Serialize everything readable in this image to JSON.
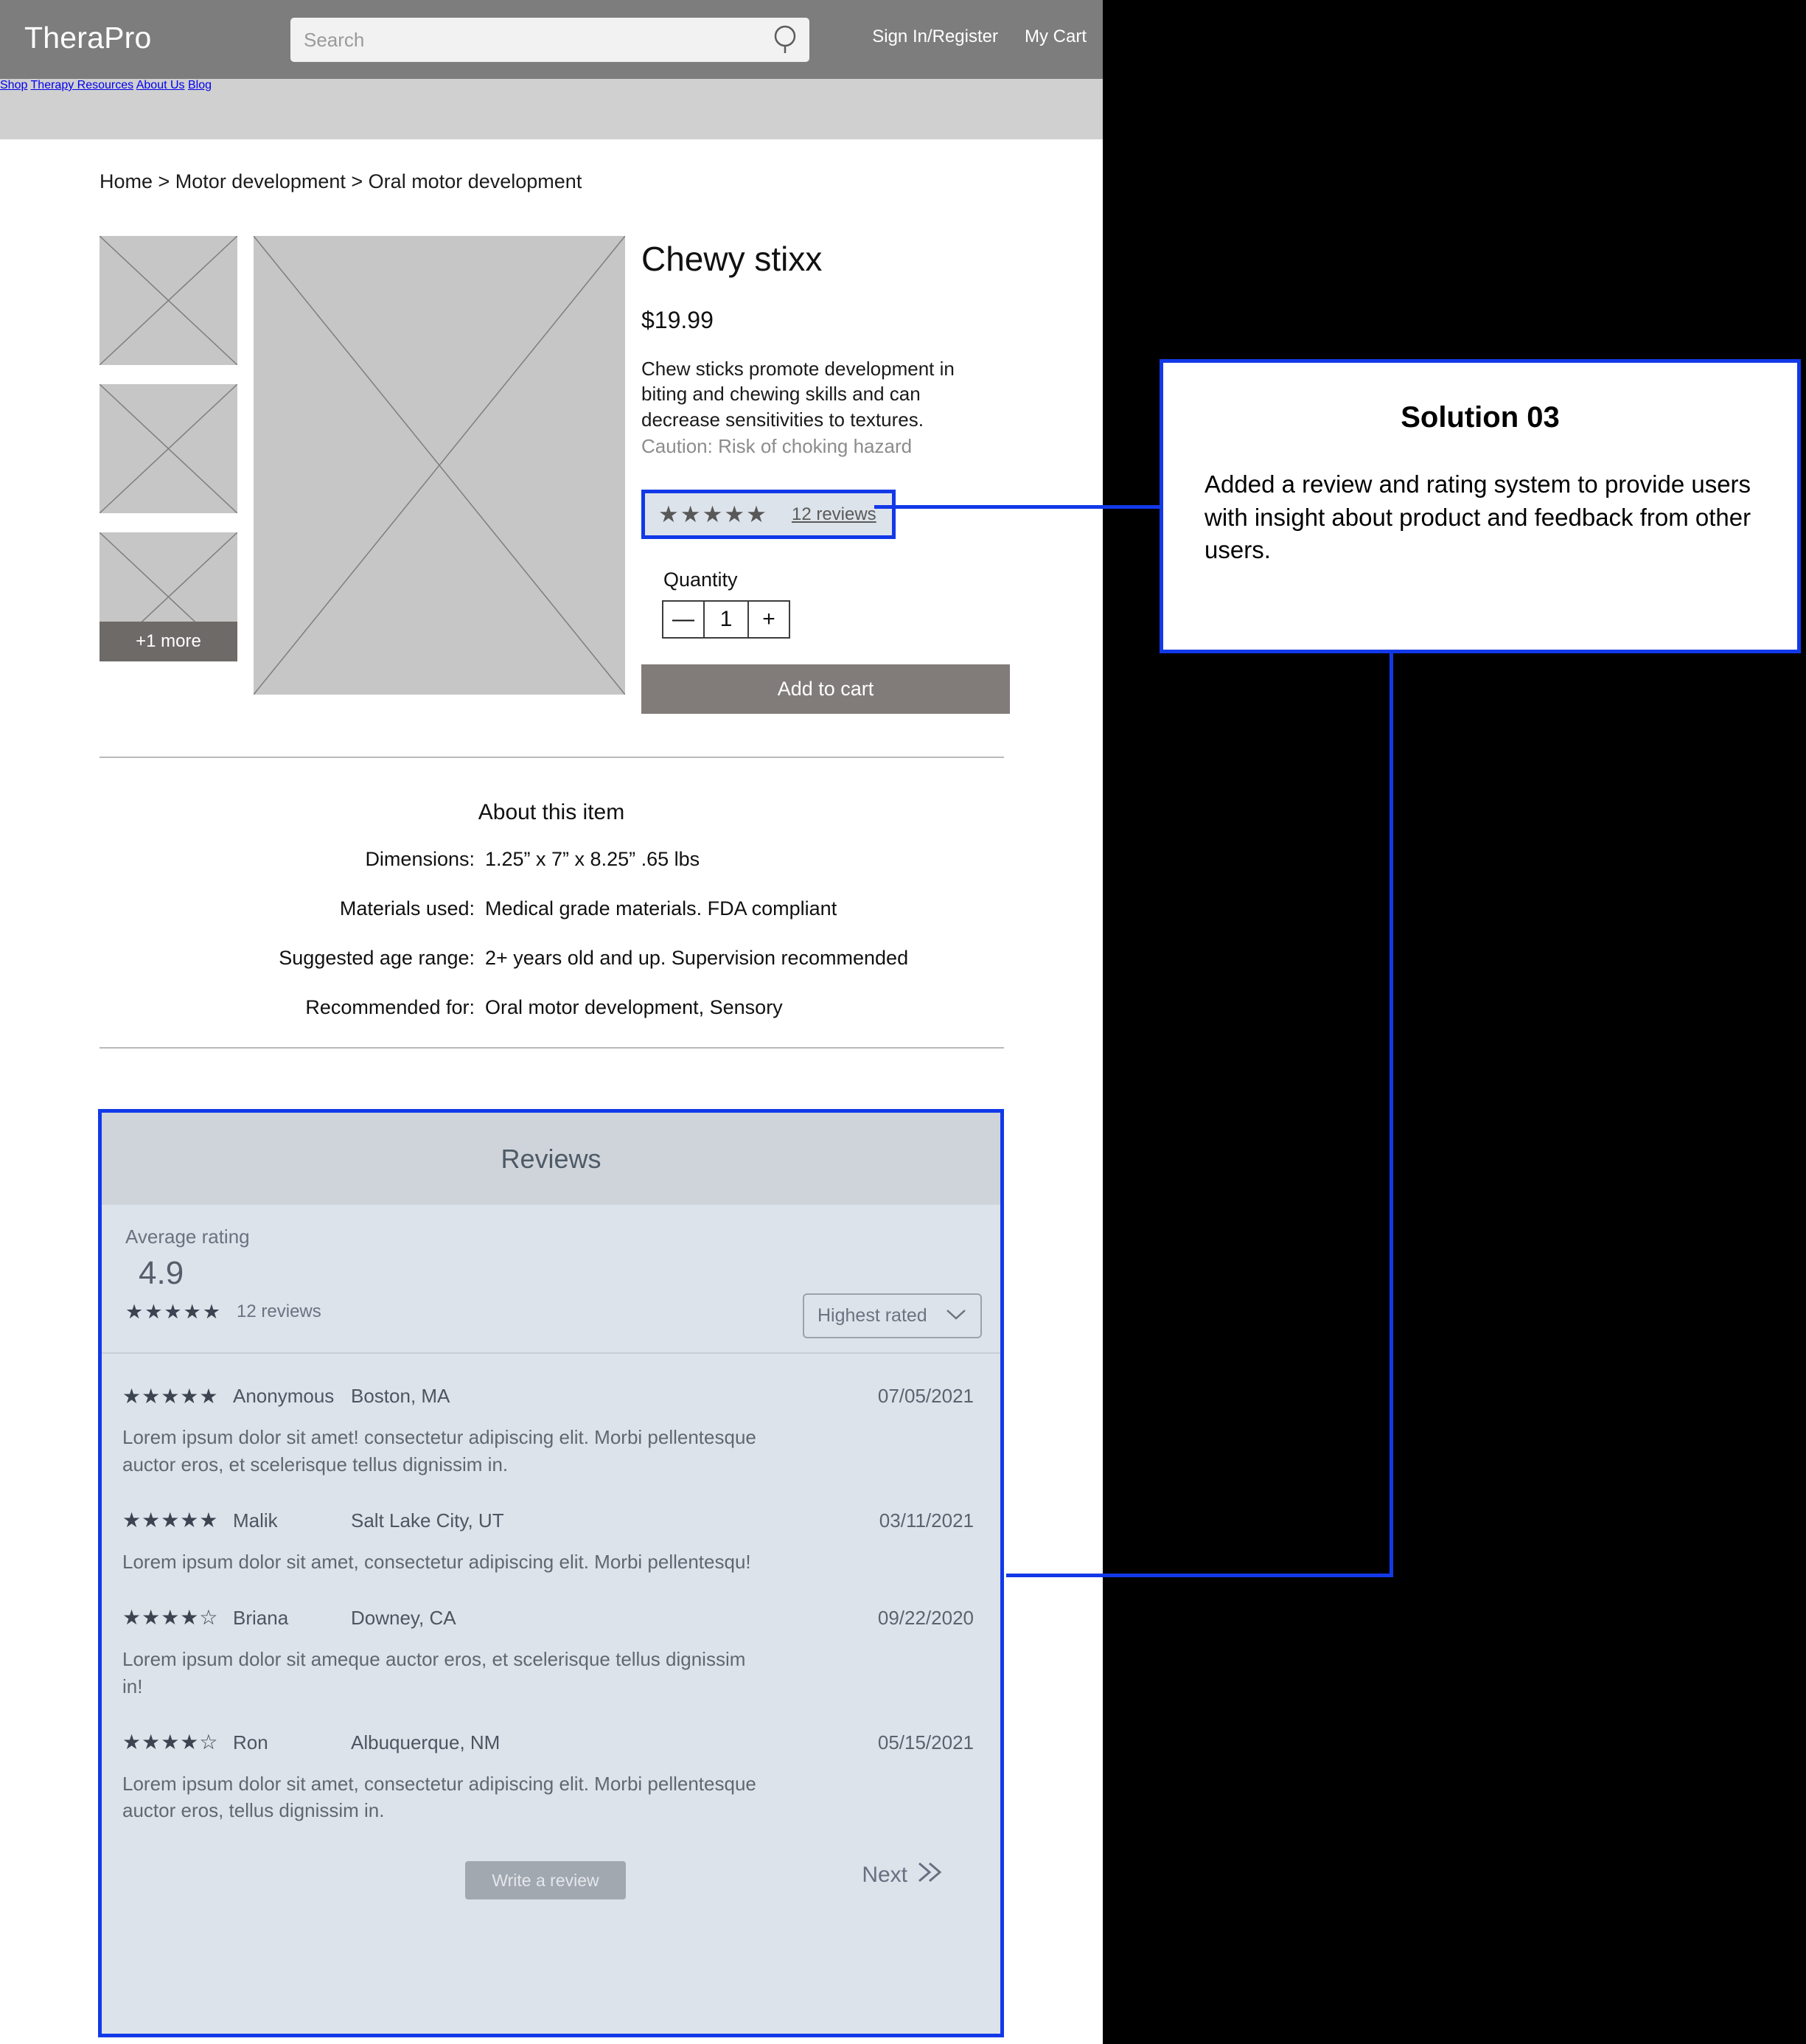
{
  "header": {
    "brand": "TheraPro",
    "search": {
      "placeholder": "Search",
      "value": "",
      "icon": "search-icon"
    },
    "sign_in": "Sign In/Register",
    "cart": "My Cart"
  },
  "nav": {
    "items": [
      "Shop",
      "Therapy Resources",
      "About Us",
      "Blog"
    ]
  },
  "breadcrumb": "Home > Motor development > Oral motor development",
  "gallery": {
    "thumb_count": 3,
    "more_label": "+1 more"
  },
  "product": {
    "title": "Chewy stixx",
    "price": "$19.99",
    "description": "Chew sticks promote development in biting and chewing skills and can decrease sensitivities to textures.",
    "caution": "Caution: Risk of choking hazard",
    "rating_stars": "★★★★★",
    "reviews_link": "12 reviews",
    "quantity_label": "Quantity",
    "quantity_value": "1",
    "minus_label": "—",
    "plus_label": "+",
    "add_to_cart": "Add to cart"
  },
  "about": {
    "title": "About this item",
    "rows": [
      {
        "key": "Dimensions:",
        "value": "1.25” x 7” x 8.25”  .65 lbs"
      },
      {
        "key": "Materials used:",
        "value": "Medical grade materials. FDA compliant"
      },
      {
        "key": "Suggested age range:",
        "value": "2+ years old and up.  Supervision recommended"
      },
      {
        "key": "Recommended for:",
        "value": "Oral motor development, Sensory"
      }
    ]
  },
  "reviews": {
    "heading": "Reviews",
    "average_label": "Average rating",
    "average_value": "4.9",
    "average_stars": "★★★★★",
    "average_count": "12 reviews",
    "sort": {
      "selected": "Highest rated",
      "chevron": "chevron-down-icon"
    },
    "items": [
      {
        "stars": "★★★★★",
        "name": "Anonymous",
        "location": "Boston, MA",
        "date": "07/05/2021",
        "body": "Lorem ipsum dolor sit amet! consectetur adipiscing elit. Morbi pellentesque auctor eros, et scelerisque tellus dignissim in."
      },
      {
        "stars": "★★★★★",
        "name": "Malik",
        "location": "Salt Lake City, UT",
        "date": "03/11/2021",
        "body": "Lorem ipsum dolor sit amet, consectetur adipiscing elit. Morbi pellentesqu!"
      },
      {
        "stars": "★★★★☆",
        "name": "Briana",
        "location": "Downey, CA",
        "date": "09/22/2020",
        "body": "Lorem ipsum dolor sit ameque auctor eros, et scelerisque tellus dignissim in!"
      },
      {
        "stars": "★★★★☆",
        "name": "Ron",
        "location": "Albuquerque, NM",
        "date": "05/15/2021",
        "body": "Lorem ipsum dolor sit amet, consectetur adipiscing elit. Morbi pellentesque auctor eros, tellus dignissim in."
      }
    ],
    "write_review": "Write a review",
    "next": "Next",
    "next_icon": "double-chevron-right-icon"
  },
  "annotation": {
    "title": "Solution 03",
    "body": "Added a review and rating system to provide users with insight about product and feedback from other users.",
    "accent_color": "#1239e8"
  },
  "colors": {
    "topbar": "#7d7d7d",
    "navbar": "#d0d0d0",
    "accent_blue": "#1239e8",
    "panel_bg": "#dde3ea",
    "panel_head": "#ced4da",
    "button_gray": "#817b79",
    "placeholder_gray": "#c6c6c6"
  }
}
